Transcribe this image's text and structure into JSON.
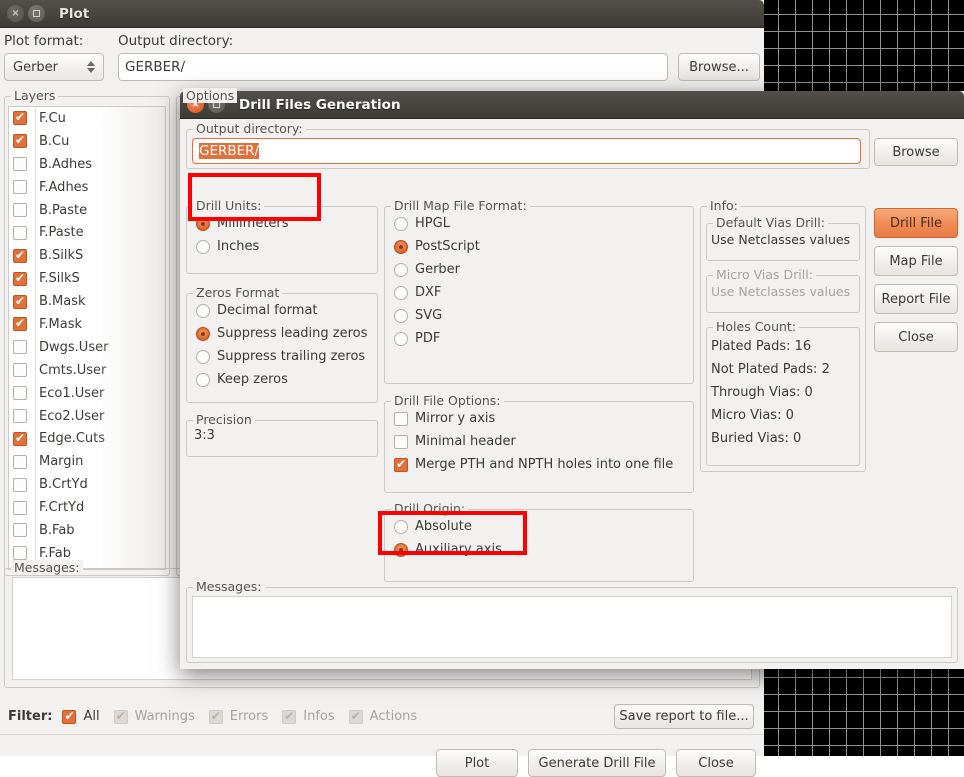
{
  "canvas": {
    "name": "pcb-editor-canvas"
  },
  "plot_window": {
    "title": "Plot",
    "plot_format_label": "Plot format:",
    "plot_format_value": "Gerber",
    "output_dir_label": "Output directory:",
    "output_dir_value": "GERBER/",
    "browse_label": "Browse...",
    "layers_label": "Layers",
    "options_label": "Options",
    "layers": [
      {
        "label": "F.Cu",
        "checked": true
      },
      {
        "label": "B.Cu",
        "checked": true
      },
      {
        "label": "B.Adhes",
        "checked": false
      },
      {
        "label": "F.Adhes",
        "checked": false
      },
      {
        "label": "B.Paste",
        "checked": false
      },
      {
        "label": "F.Paste",
        "checked": false
      },
      {
        "label": "B.SilkS",
        "checked": true
      },
      {
        "label": "F.SilkS",
        "checked": true
      },
      {
        "label": "B.Mask",
        "checked": true
      },
      {
        "label": "F.Mask",
        "checked": true
      },
      {
        "label": "Dwgs.User",
        "checked": false
      },
      {
        "label": "Cmts.User",
        "checked": false
      },
      {
        "label": "Eco1.User",
        "checked": false
      },
      {
        "label": "Eco2.User",
        "checked": false
      },
      {
        "label": "Edge.Cuts",
        "checked": true
      },
      {
        "label": "Margin",
        "checked": false
      },
      {
        "label": "B.CrtYd",
        "checked": false
      },
      {
        "label": "F.CrtYd",
        "checked": false
      },
      {
        "label": "B.Fab",
        "checked": false
      },
      {
        "label": "F.Fab",
        "checked": false
      }
    ],
    "messages_label": "Messages:",
    "filter_label": "Filter:",
    "filters": [
      {
        "label": "All",
        "checked": true,
        "enabled": true
      },
      {
        "label": "Warnings",
        "checked": true,
        "enabled": false
      },
      {
        "label": "Errors",
        "checked": true,
        "enabled": false
      },
      {
        "label": "Infos",
        "checked": true,
        "enabled": false
      },
      {
        "label": "Actions",
        "checked": true,
        "enabled": false
      }
    ],
    "save_report_label": "Save report to file...",
    "buttons": {
      "plot": "Plot",
      "generate_drill_file": "Generate Drill File",
      "close": "Close"
    }
  },
  "drill_dialog": {
    "title": "Drill Files Generation",
    "output_dir_label": "Output directory:",
    "output_dir_value": "GERBER/",
    "browse_label": "Browse",
    "drill_units": {
      "label": "Drill Units:",
      "options": [
        {
          "label": "Millimeters",
          "selected": true
        },
        {
          "label": "Inches",
          "selected": false
        }
      ]
    },
    "zeros_format": {
      "label": "Zeros Format",
      "options": [
        {
          "label": "Decimal format",
          "selected": false
        },
        {
          "label": "Suppress leading zeros",
          "selected": true
        },
        {
          "label": "Suppress trailing zeros",
          "selected": false
        },
        {
          "label": "Keep zeros",
          "selected": false
        }
      ]
    },
    "precision": {
      "label": "Precision",
      "value": "3:3"
    },
    "drill_map_file_format": {
      "label": "Drill Map File Format:",
      "options": [
        {
          "label": "HPGL",
          "selected": false
        },
        {
          "label": "PostScript",
          "selected": true
        },
        {
          "label": "Gerber",
          "selected": false
        },
        {
          "label": "DXF",
          "selected": false
        },
        {
          "label": "SVG",
          "selected": false
        },
        {
          "label": "PDF",
          "selected": false
        }
      ]
    },
    "drill_file_options": {
      "label": "Drill File Options:",
      "options": [
        {
          "label": "Mirror y axis",
          "checked": false
        },
        {
          "label": "Minimal header",
          "checked": false
        },
        {
          "label": "Merge PTH and NPTH holes into one file",
          "checked": true
        }
      ]
    },
    "drill_origin": {
      "label": "Drill Origin:",
      "options": [
        {
          "label": "Absolute",
          "selected": false
        },
        {
          "label": "Auxiliary axis",
          "selected": true
        }
      ]
    },
    "info": {
      "label": "Info:",
      "default_vias_drill": {
        "label": "Default Vias Drill:",
        "value": "Use Netclasses values"
      },
      "micro_vias_drill": {
        "label": "Micro Vias Drill:",
        "value": "Use Netclasses values"
      },
      "holes_count": {
        "label": "Holes Count:",
        "rows": [
          "Plated Pads: 16",
          "Not Plated Pads: 2",
          "Through Vias: 0",
          "Micro Vias: 0",
          "Buried Vias: 0"
        ]
      }
    },
    "action_buttons": [
      {
        "label": "Drill File",
        "accent": true
      },
      {
        "label": "Map File",
        "accent": false
      },
      {
        "label": "Report File",
        "accent": false
      },
      {
        "label": "Close",
        "accent": false
      }
    ],
    "messages_label": "Messages:"
  },
  "annotations": {
    "color": "#ff0000",
    "boxes": [
      "drill-units-millimeters",
      "drill-origin-auxiliary-axis"
    ]
  }
}
